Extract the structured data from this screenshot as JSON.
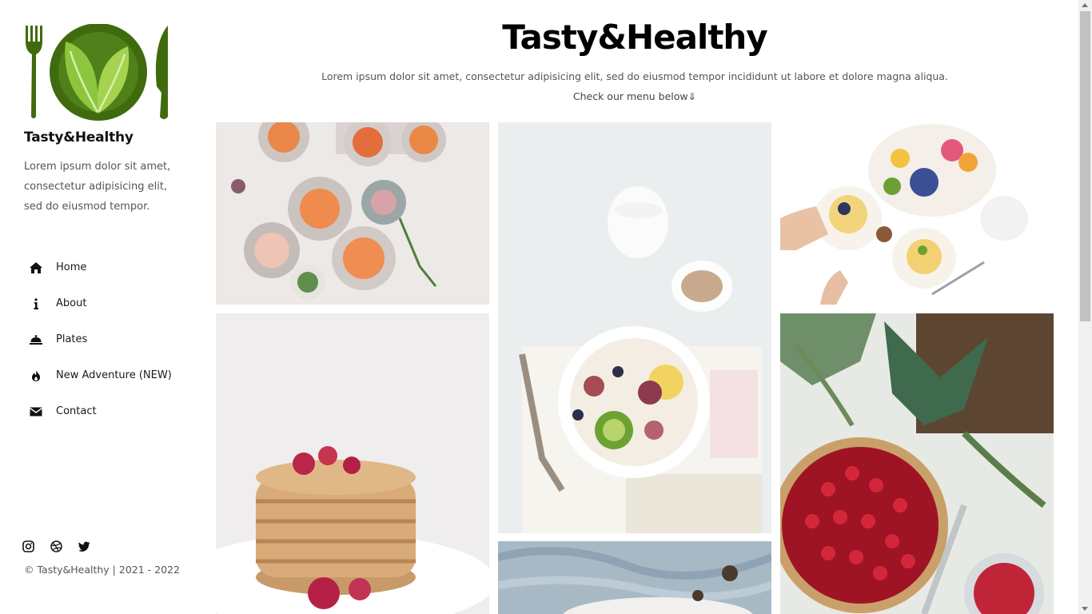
{
  "brand": {
    "title": "Tasty&Healthy",
    "description": "Lorem ipsum dolor sit amet, consectetur adipisicing elit, sed do eiusmod tempor.",
    "logo_icon": "plate-leaf-fork-knife-logo",
    "accent_color": "#3f6b0e"
  },
  "nav": {
    "items": [
      {
        "label": "Home",
        "icon": "home-icon"
      },
      {
        "label": "About",
        "icon": "info-icon"
      },
      {
        "label": "Plates",
        "icon": "cloche-icon"
      },
      {
        "label": "New Adventure (NEW)",
        "icon": "fire-icon"
      },
      {
        "label": "Contact",
        "icon": "envelope-icon"
      }
    ]
  },
  "social": [
    "instagram-icon",
    "dribbble-icon",
    "twitter-icon"
  ],
  "footer": {
    "copyright": "© Tasty&Healthy | 2021 - 2022"
  },
  "main": {
    "title": "Tasty&Healthy",
    "lead": "Lorem ipsum dolor sit amet, consectetur adipisicing elit, sed do eiusmod tempor incididunt ut labore et dolore magna aliqua.",
    "cta": "Check our menu below⇓"
  },
  "gallery": [
    {
      "name": "grapefruit-plates-photo"
    },
    {
      "name": "pancake-stack-photo"
    },
    {
      "name": "yogurt-bowl-photo"
    },
    {
      "name": "linen-bowl-photo"
    },
    {
      "name": "fruit-breakfast-photo"
    },
    {
      "name": "berry-tart-photo"
    }
  ]
}
